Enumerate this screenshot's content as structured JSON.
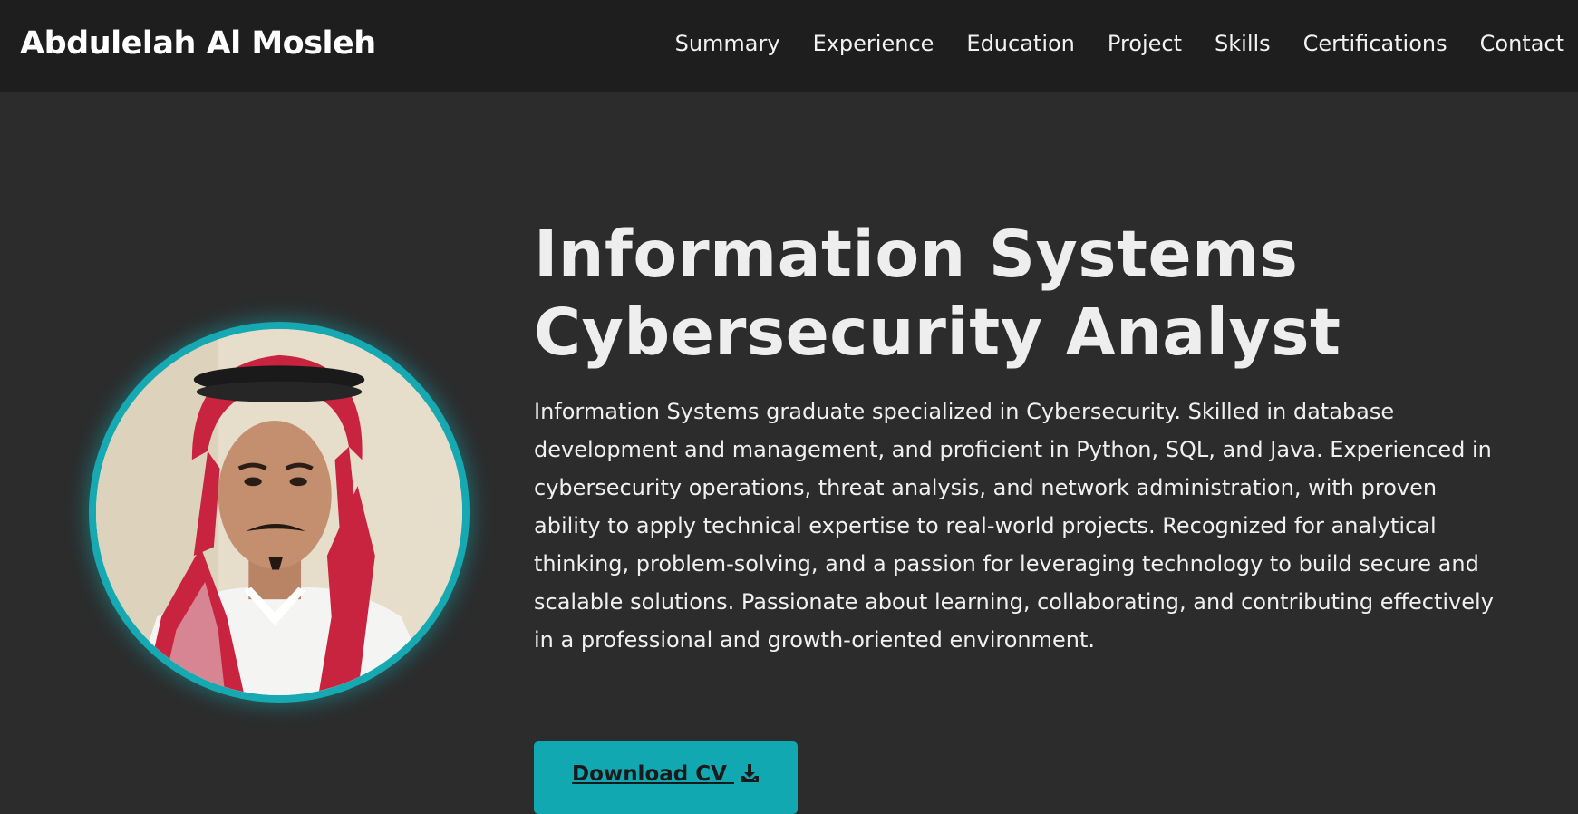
{
  "header": {
    "brand": "Abdulelah Al Mosleh",
    "nav": [
      {
        "label": "Summary"
      },
      {
        "label": "Experience"
      },
      {
        "label": "Education"
      },
      {
        "label": "Project"
      },
      {
        "label": "Skills"
      },
      {
        "label": "Certifications"
      },
      {
        "label": "Contact"
      }
    ]
  },
  "hero": {
    "title_line1": "Information Systems",
    "title_line2": "Cybersecurity Analyst",
    "summary": "Information Systems graduate specialized in Cybersecurity. Skilled in database development and management, and proficient in Python, SQL, and Java. Experienced in cybersecurity operations, threat analysis, and network administration, with proven ability to apply technical expertise to real-world projects. Recognized for analytical thinking, problem-solving, and a passion for leveraging technology to build secure and scalable solutions. Passionate about learning, collaborating, and contributing effectively in a professional and growth-oriented environment.",
    "cv_button": "Download CV",
    "cv_icon": "download-icon"
  },
  "colors": {
    "accent": "#12a8b1",
    "navbar_bg": "#1e1e1e",
    "page_bg": "#2c2c2c",
    "text": "#f0f0f0"
  }
}
